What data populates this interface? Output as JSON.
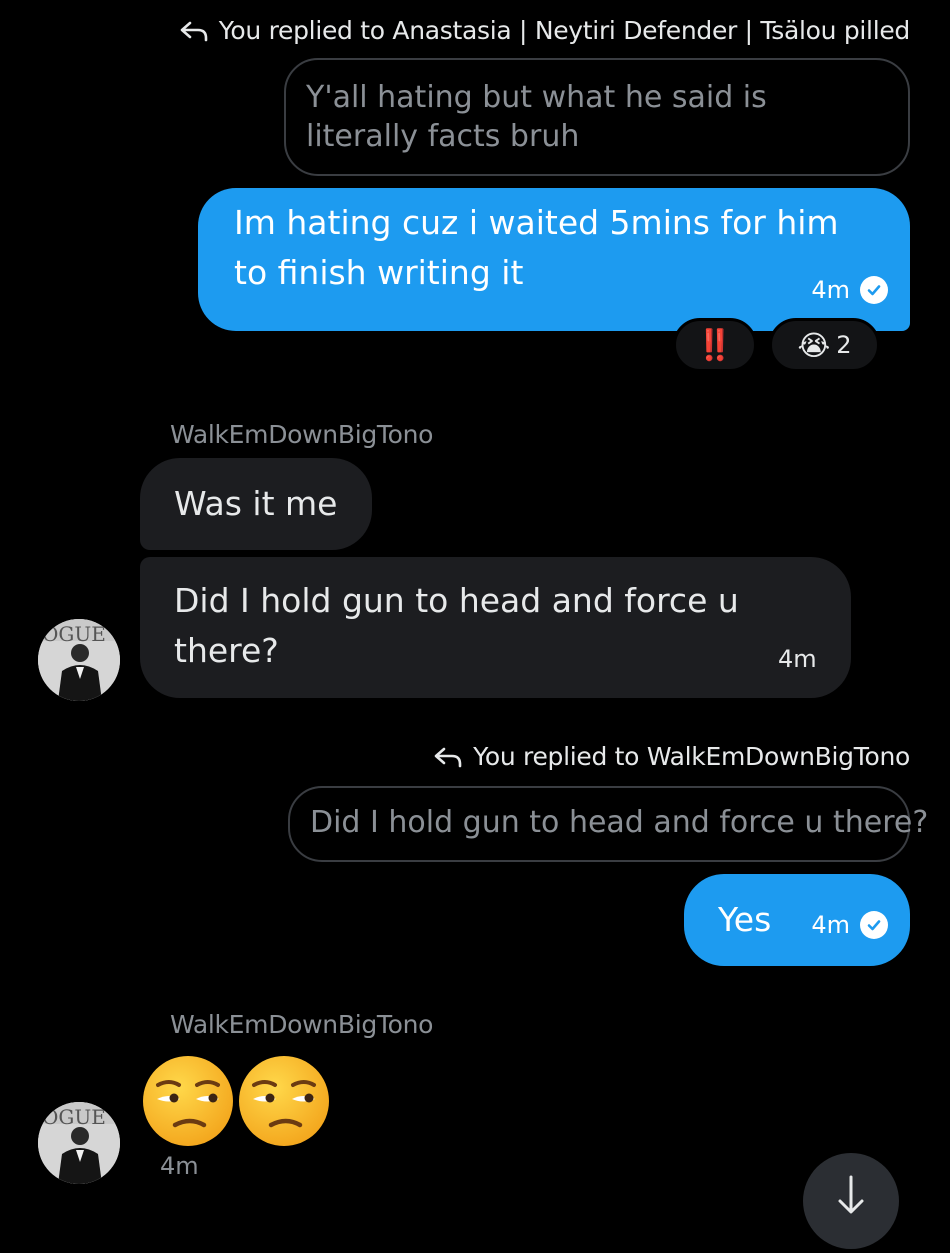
{
  "thread": {
    "reply_1": {
      "header": "You replied to Anastasia | Neytiri Defender | Tsälou pilled",
      "quoted_text": "Y'all hating but what he said is literally facts bruh"
    },
    "msg_1": {
      "text": "Im hating cuz i waited 5mins for him to finish writing it",
      "time": "4m"
    },
    "reactions": [
      {
        "emoji": "‼️",
        "count": ""
      },
      {
        "emoji": "😭",
        "count": "2"
      }
    ],
    "group_1": {
      "sender": "WalkEmDownBigTono",
      "messages": [
        {
          "text": "Was it me",
          "time": ""
        },
        {
          "text": "Did I hold gun to head and force u there?",
          "time": "4m"
        }
      ]
    },
    "reply_2": {
      "header": "You replied to WalkEmDownBigTono",
      "quoted_text": "Did I hold gun to head and force u there?"
    },
    "msg_2": {
      "text": "Yes",
      "time": "4m"
    },
    "group_2": {
      "sender": "WalkEmDownBigTono",
      "emoji_text": "😒😒",
      "time": "4m"
    }
  },
  "colors": {
    "background": "#000000",
    "sent_bubble": "#1d9bf0",
    "received_bubble": "#1c1d20",
    "muted_text": "#8b9096",
    "quoted_border": "#3a3d42"
  },
  "icons": [
    "reply-arrow-icon",
    "read-check-icon",
    "avatar",
    "scroll-down-icon"
  ]
}
